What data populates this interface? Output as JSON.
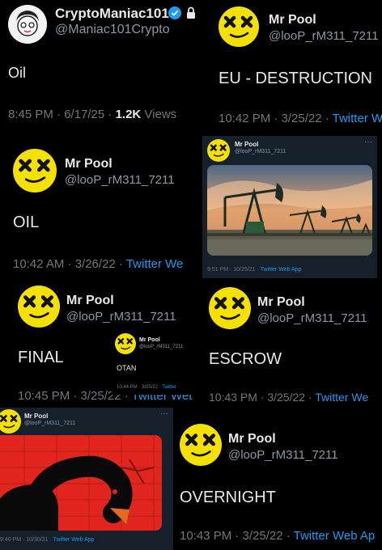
{
  "tweet_main": {
    "name": "CryptoManiac101",
    "handle": "@Maniac101Crypto",
    "text": "Oil",
    "time": "8:45 PM · 6/17/25 · ",
    "views_count": "1.2K",
    "views_label": " Views"
  },
  "tweet_eu": {
    "name": "Mr Pool",
    "handle": "@looP_rM311_7211",
    "text": "EU - DESTRUCTION",
    "time": "10:42 PM · 3/25/22 · ",
    "source": "Twitter W"
  },
  "tweet_oil": {
    "name": "Mr Pool",
    "handle": "@looP_rM311_7211",
    "text": "OIL",
    "time": "10:42 AM · 3/26/22 · ",
    "source": "Twitter We"
  },
  "tweet_pump": {
    "name": "Mr Pool",
    "handle": "@looP_rM311_7211",
    "footer": "9:51 PM · 10/25/21 · ",
    "source": "Twitter Web App"
  },
  "tweet_final": {
    "name": "Mr Pool",
    "handle": "@looP_rM311_7211",
    "text": "FINAL",
    "time": "10:45 PM · 3/25/22 · ",
    "source": "Twitter Wet"
  },
  "tweet_otan": {
    "name": "Mr Pool",
    "handle": "@looP_rM311_7211",
    "text": "OTAN",
    "time": "10:44 PM · 3/25/22 · ",
    "source": "Twitter"
  },
  "tweet_escrow": {
    "name": "Mr Pool",
    "handle": "@looP_rM311_7211",
    "text": "ESCROW",
    "time": "10:43 PM · 3/25/22 · ",
    "source": "Twitter We"
  },
  "tweet_swan": {
    "name": "Mr Pool",
    "handle": "@looP_rM311_7211",
    "footer": "9:40 PM · 10/30/21 · ",
    "source": "Twitter Web App"
  },
  "tweet_overnight": {
    "name": "Mr Pool",
    "handle": "@looP_rM311_7211",
    "text": "OVERNIGHT",
    "time": "10:43 PM · 3/25/22 · ",
    "source": "Twitter Web Ap"
  },
  "colors": {
    "link": "#1d9bf0",
    "verified": "#1d9bf0",
    "avatar_yellow": "#f5e100",
    "swan_red": "#e0261e"
  },
  "icons": [
    "verified-badge-icon",
    "lock-icon",
    "more-icon"
  ]
}
